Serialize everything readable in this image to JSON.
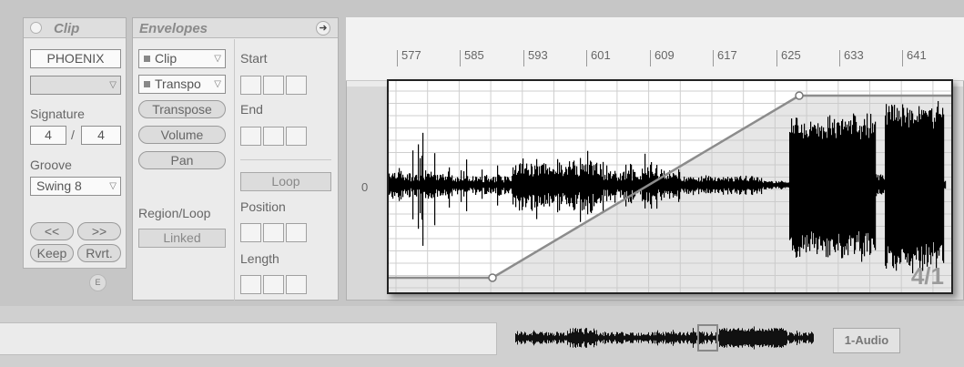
{
  "clip_panel": {
    "title": "Clip",
    "name": "PHOENIX",
    "color_select": "",
    "signature_label": "Signature",
    "signature_numerator": "4",
    "signature_separator": "/",
    "signature_denominator": "4",
    "groove_label": "Groove",
    "groove_value": "Swing 8",
    "nudge_back": "<<",
    "nudge_forward": ">>",
    "keep": "Keep",
    "revert": "Rvrt.",
    "e_badge": "E"
  },
  "envelopes_panel": {
    "title": "Envelopes",
    "device_chooser": "Clip",
    "control_chooser": "Transpo",
    "buttons": [
      "Transpose",
      "Volume",
      "Pan"
    ],
    "region_loop_label": "Region/Loop",
    "linked": "Linked",
    "start_label": "Start",
    "end_label": "End",
    "loop_button": "Loop",
    "position_label": "Position",
    "length_label": "Length"
  },
  "timeline": {
    "markers": [
      "577",
      "585",
      "593",
      "601",
      "609",
      "617",
      "625",
      "633",
      "641"
    ]
  },
  "sample_editor": {
    "zero_label": "0",
    "envelope_value": "4/1"
  },
  "bottom_bar": {
    "track_button": "1-Audio"
  },
  "colors": {
    "panel_bg": "#ebebeb",
    "header_bg": "#dedede",
    "waveform": "#000000",
    "envelope_line": "#8c8c8c",
    "envelope_fill": "#c8c8c8"
  }
}
